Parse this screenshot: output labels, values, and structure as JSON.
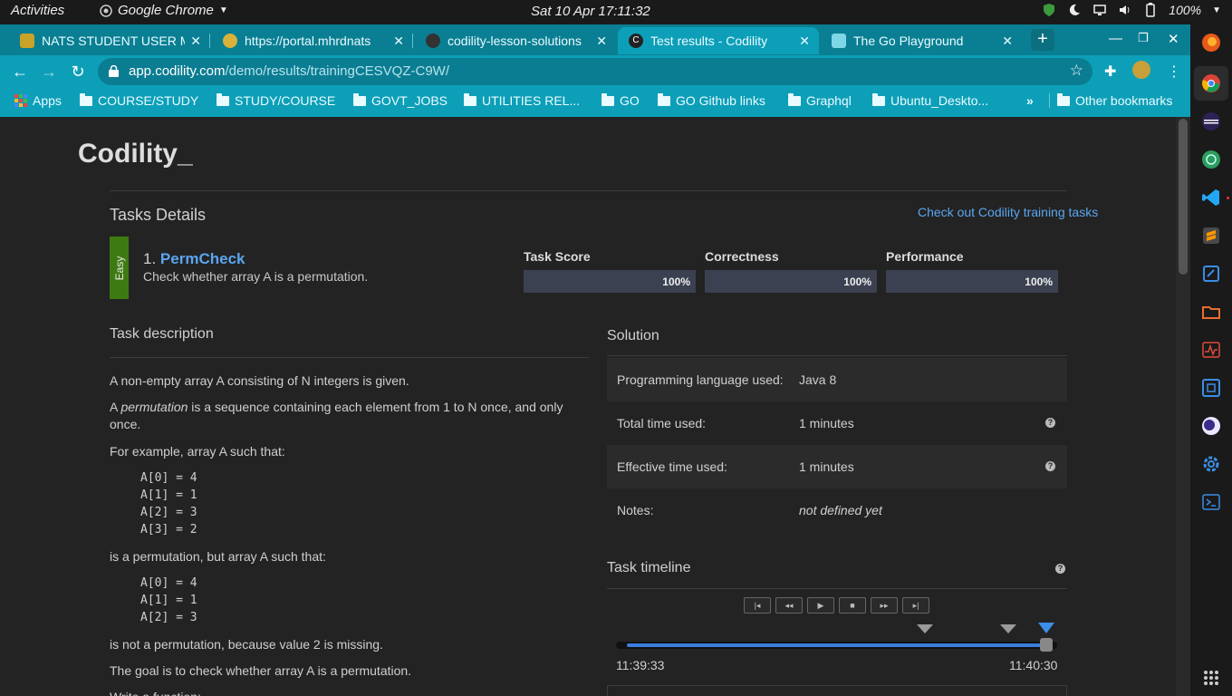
{
  "system": {
    "activities": "Activities",
    "app_menu": "Google Chrome",
    "clock": "Sat 10 Apr  17:11:32",
    "battery": "100%"
  },
  "browser": {
    "tabs": [
      {
        "label": "NATS STUDENT USER M",
        "favicon_color": "#c9a227"
      },
      {
        "label": "https://portal.mhrdnats",
        "favicon_color": "#d8b23a"
      },
      {
        "label": "codility-lesson-solutions",
        "favicon_color": "#333333"
      },
      {
        "label": "Test results - Codility",
        "favicon_color": "#222222"
      },
      {
        "label": "The Go Playground",
        "favicon_color": "#7fd6e6"
      }
    ],
    "url_host": "app.codility.com",
    "url_path": "/demo/results/trainingCESVQZ-C9W/",
    "bookmarks": [
      "Apps",
      "COURSE/STUDY",
      "STUDY/COURSE",
      "GOVT_JOBS",
      "UTILITIES REL...",
      "GO",
      "GO Github links",
      "Graphql",
      "Ubuntu_Deskto...",
      "Other bookmarks"
    ],
    "bookmarks_overflow": "»"
  },
  "page": {
    "logo_text": "Codility_",
    "tasks_details_title": "Tasks Details",
    "training_link": "Check out Codility training tasks",
    "task": {
      "difficulty": "Easy",
      "number": "1.",
      "name": "PermCheck",
      "subtitle": "Check whether array A is a permutation.",
      "scores": [
        {
          "label": "Task Score",
          "value": "100%",
          "fraction": 1.0
        },
        {
          "label": "Correctness",
          "value": "100%",
          "fraction": 1.0
        },
        {
          "label": "Performance",
          "value": "100%",
          "fraction": 1.0
        }
      ]
    },
    "description": {
      "title": "Task description",
      "p1": "A non-empty array A consisting of N integers is given.",
      "p2_prefix": "A ",
      "p2_em": "permutation",
      "p2_line1_rest": " is a sequence containing each element from 1 to N once, and only",
      "p2_line2": "once.",
      "p3": "For example, array A such that:",
      "code1": "A[0] = 4\nA[1] = 1\nA[2] = 3\nA[3] = 2",
      "p4": "is a permutation, but array A such that:",
      "code2": "A[0] = 4\nA[1] = 1\nA[2] = 3",
      "p5": "is not a permutation, because value 2 is missing.",
      "p6": "The goal is to check whether array A is a permutation.",
      "p7": "Write a function:"
    },
    "solution": {
      "title": "Solution",
      "rows": [
        {
          "key": "Programming language used:",
          "value": "Java 8"
        },
        {
          "key": "Total time used:",
          "value": "1 minutes"
        },
        {
          "key": "Effective time used:",
          "value": "1 minutes"
        },
        {
          "key": "Notes:",
          "value": "not defined yet"
        }
      ]
    },
    "timeline": {
      "title": "Task timeline",
      "buttons": [
        "|◂",
        "◂◂",
        "▶",
        "■",
        "▸▸",
        "▸|"
      ],
      "start_time": "11:39:33",
      "end_time": "11:40:30"
    }
  }
}
